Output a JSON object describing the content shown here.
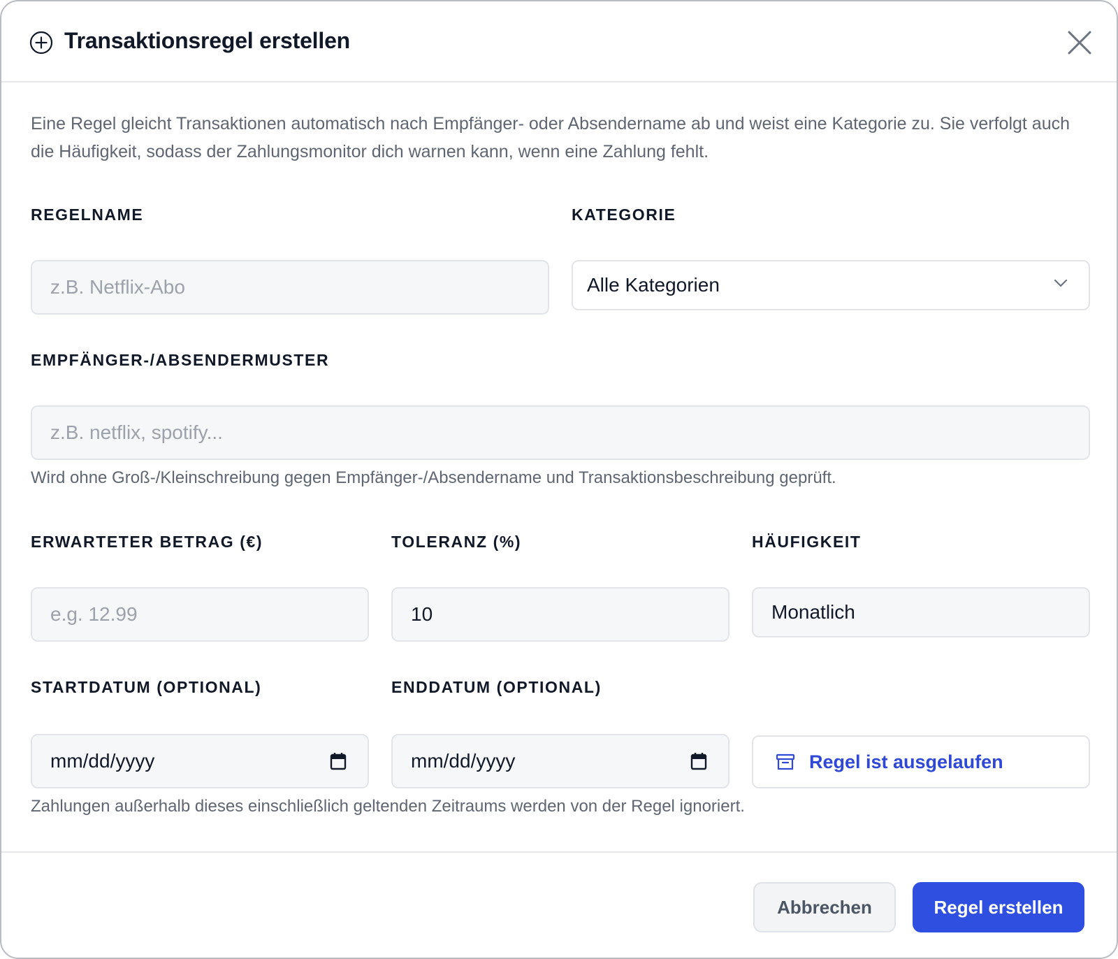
{
  "dialog": {
    "title": "Transaktionsregel erstellen",
    "description": "Eine Regel gleicht Transaktionen automatisch nach Empfänger- oder Absendername ab und weist eine Kategorie zu. Sie verfolgt auch die Häufigkeit, sodass der Zahlungsmonitor dich warnen kann, wenn eine Zahlung fehlt."
  },
  "form": {
    "rule_name": {
      "label": "REGELNAME",
      "placeholder": "z.B. Netflix-Abo",
      "value": ""
    },
    "category": {
      "label": "KATEGORIE",
      "selected": "Alle Kategorien"
    },
    "pattern": {
      "label": "EMPFÄNGER-/ABSENDERMUSTER",
      "placeholder": "z.B. netflix, spotify...",
      "value": "",
      "hint": "Wird ohne Groß-/Kleinschreibung gegen Empfänger-/Absendername und Transaktionsbeschreibung geprüft."
    },
    "amount": {
      "label": "ERWARTETER BETRAG (€)",
      "placeholder": "e.g. 12.99",
      "value": ""
    },
    "tolerance": {
      "label": "TOLERANZ (%)",
      "value": "10"
    },
    "frequency": {
      "label": "HÄUFIGKEIT",
      "selected": "Monatlich"
    },
    "start_date": {
      "label": "STARTDATUM (OPTIONAL)",
      "placeholder": "mm/dd/yyyy"
    },
    "end_date": {
      "label": "ENDDATUM (OPTIONAL)",
      "placeholder": "mm/dd/yyyy"
    },
    "expired_toggle": "Regel ist ausgelaufen",
    "date_hint": "Zahlungen außerhalb dieses einschließlich geltenden Zeitraums werden von der Regel ignoriert."
  },
  "footer": {
    "cancel_label": "Abbrechen",
    "submit_label": "Regel erstellen"
  },
  "colors": {
    "primary": "#2f4fe0",
    "link": "#2f48d6"
  }
}
